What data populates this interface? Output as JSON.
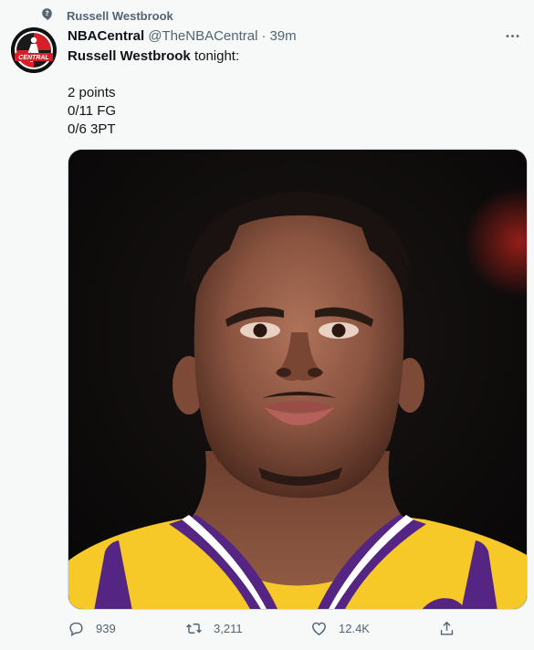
{
  "context": {
    "label": "Russell Westbrook",
    "icon": "topic-icon"
  },
  "author": {
    "name": "NBACentral",
    "handle": "@TheNBACentral",
    "separator": "·",
    "time": "39m",
    "avatar_text": "CENTRAL"
  },
  "tweet": {
    "mention": "Russell Westbrook",
    "lead_text": "tonight:",
    "stats": [
      "2 points",
      "0/11 FG",
      "0/6 3PT"
    ]
  },
  "actions": {
    "reply_count": "939",
    "retweet_count": "3,211",
    "like_count": "12.4K"
  },
  "colors": {
    "background": "#f7f9f9",
    "text_primary": "#0f1419",
    "text_secondary": "#536471",
    "jersey_gold": "#f7c928",
    "jersey_purple": "#552583"
  }
}
